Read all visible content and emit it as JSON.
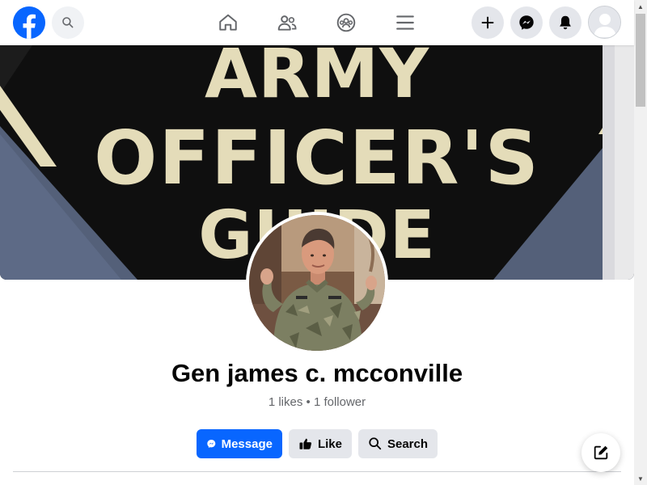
{
  "topbar": {
    "logo_icon": "facebook-logo-icon",
    "search_icon": "search-icon",
    "nav_icons": [
      "home-icon",
      "friends-icon",
      "groups-icon",
      "menu-icon"
    ],
    "right_icons": [
      "plus-icon",
      "messenger-icon",
      "bell-icon",
      "avatar"
    ]
  },
  "cover": {
    "line1": "ARMY",
    "line2": "OFFICER'S",
    "line3": "GUIDE",
    "colors": {
      "background": "#111111",
      "text": "#e4dcb9",
      "accent": "#546079"
    }
  },
  "profile": {
    "name": "Gen james c. mcconville",
    "stats": "1 likes • 1 follower"
  },
  "actions": {
    "message_label": "Message",
    "like_label": "Like",
    "search_label": "Search"
  },
  "colors": {
    "brand": "#0866ff",
    "secondary_button": "#e4e6eb",
    "muted_text": "#65676b"
  }
}
